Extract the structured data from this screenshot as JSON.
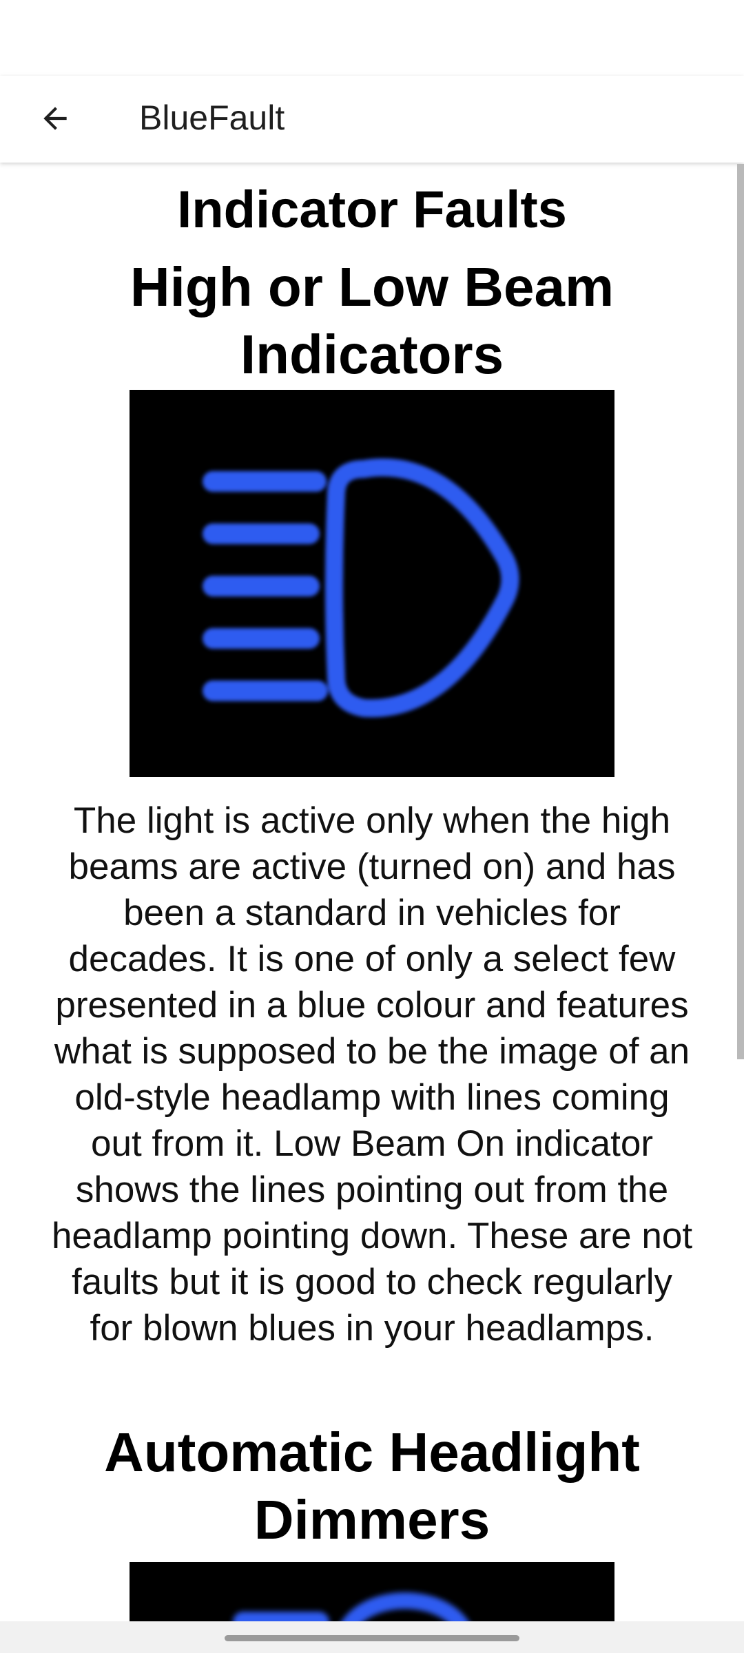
{
  "app_bar": {
    "title": "BlueFault",
    "back_icon": "arrow-left-icon"
  },
  "content": {
    "heading_main": "Indicator Faults",
    "section1": {
      "heading": "High or Low Beam Indicators",
      "image_icon": "high-beam-headlamp-icon",
      "description": "The light is active only when the high beams are active (turned on) and has been a standard in vehicles for decades. It is one of only a select few presented in a blue colour and features what is supposed to be the image of an old-style headlamp with lines coming out from it. Low Beam On indicator shows the lines pointing out from the headlamp pointing down. These are not faults but it is good to check regularly for blown blues in your headlamps."
    },
    "section2": {
      "heading": "Automatic Headlight Dimmers",
      "image_icon": "headlight-dimmer-icon"
    }
  },
  "colors": {
    "indicator_blue": "#2f5cf0",
    "image_background": "#000000",
    "scrollbar": "#b9b9b9"
  }
}
